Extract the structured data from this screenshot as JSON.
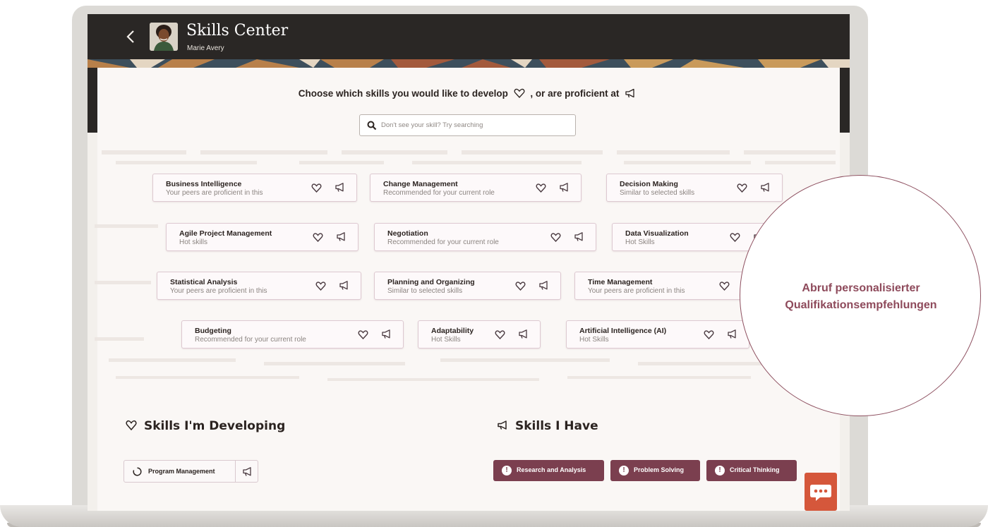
{
  "header": {
    "back_icon": "chevron-left-icon",
    "app_title": "Skills Center",
    "user_name": "Marie Avery"
  },
  "prompt": {
    "text_before": "Choose which skills you would like to develop",
    "text_middle": ", or are proficient at",
    "develop_icon": "heart-icon",
    "proficient_icon": "megaphone-icon"
  },
  "search": {
    "placeholder": "Don't see your skill? Try searching",
    "icon": "search-icon"
  },
  "skills": [
    {
      "title": "Business Intelligence",
      "subtitle": "Your peers are proficient in this"
    },
    {
      "title": "Change Management",
      "subtitle": "Recommended for your current role"
    },
    {
      "title": "Decision Making",
      "subtitle": "Similar to selected skills"
    },
    {
      "title": "Agile Project Management",
      "subtitle": "Hot skills"
    },
    {
      "title": "Negotiation",
      "subtitle": "Recommended for your current role"
    },
    {
      "title": "Data Visualization",
      "subtitle": "Hot Skills"
    },
    {
      "title": "Statistical Analysis",
      "subtitle": "Your peers are proficient in this"
    },
    {
      "title": "Planning and Organizing",
      "subtitle": "Similar to selected skills"
    },
    {
      "title": "Time Management",
      "subtitle": "Your peers are proficient in this"
    },
    {
      "title": "Budgeting",
      "subtitle": "Recommended for your current role"
    },
    {
      "title": "Adaptability",
      "subtitle": "Hot Skills"
    },
    {
      "title": "Artificial Intelligence (AI)",
      "subtitle": "Hot Skills"
    }
  ],
  "developing": {
    "heading": "Skills I'm Developing",
    "items": [
      {
        "label": "Program Management"
      }
    ]
  },
  "have": {
    "heading": "Skills I Have",
    "items": [
      {
        "label": "Research and Analysis"
      },
      {
        "label": "Problem Solving"
      },
      {
        "label": "Critical Thinking"
      }
    ]
  },
  "callout": {
    "line1": "Abruf personalisierter",
    "line2": "Qualifikationsempfehlungen"
  },
  "colors": {
    "header_bg": "#2a2725",
    "accent": "#7b3f4f",
    "chat_button": "#d5573b",
    "callout_text": "#8e4a5b"
  }
}
